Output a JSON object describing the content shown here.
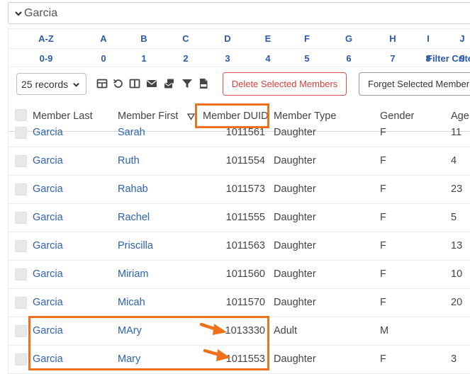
{
  "search": {
    "value": "Garcia"
  },
  "letters_row1": [
    "A-Z",
    "A",
    "B",
    "C",
    "D",
    "E",
    "F",
    "G",
    "H",
    "I",
    "J"
  ],
  "letters_row2": [
    "0-9",
    "0",
    "1",
    "2",
    "3",
    "4",
    "5",
    "6",
    "7",
    "8",
    "9"
  ],
  "filter_link": "Filter Criter",
  "toolbar": {
    "records_select": "25 records",
    "delete_label": "Delete Selected Members",
    "forget_label": "Forget Selected Member",
    "icons": [
      "table-icon",
      "undo-icon",
      "columns-icon",
      "envelope-icon",
      "mail-merge-icon",
      "filter-icon",
      "csv-icon"
    ]
  },
  "table": {
    "headers": [
      "Member Last",
      "Member First",
      "Member DUID",
      "Member Type",
      "Gender",
      "Age"
    ],
    "rows": [
      {
        "last": "Garcia",
        "first": "Sarah",
        "duid": "1011561",
        "type": "Daughter",
        "gender": "F",
        "age": "11"
      },
      {
        "last": "Garcia",
        "first": "Ruth",
        "duid": "1011554",
        "type": "Daughter",
        "gender": "F",
        "age": "4"
      },
      {
        "last": "Garcia",
        "first": "Rahab",
        "duid": "1011573",
        "type": "Daughter",
        "gender": "F",
        "age": "23"
      },
      {
        "last": "Garcia",
        "first": "Rachel",
        "duid": "1011555",
        "type": "Daughter",
        "gender": "F",
        "age": "5"
      },
      {
        "last": "Garcia",
        "first": "Priscilla",
        "duid": "1011563",
        "type": "Daughter",
        "gender": "F",
        "age": "13"
      },
      {
        "last": "Garcia",
        "first": "Miriam",
        "duid": "1011560",
        "type": "Daughter",
        "gender": "F",
        "age": "10"
      },
      {
        "last": "Garcia",
        "first": "Micah",
        "duid": "1011570",
        "type": "Daughter",
        "gender": "F",
        "age": "20"
      },
      {
        "last": "Garcia",
        "first": "MAry",
        "duid": "1013330",
        "type": "Adult",
        "gender": "M",
        "age": ""
      },
      {
        "last": "Garcia",
        "first": "Mary",
        "duid": "1011553",
        "type": "Daughter",
        "gender": "F",
        "age": "3"
      }
    ]
  },
  "colors": {
    "link": "#2a63b7",
    "highlight": "#f26f1c",
    "danger": "#d43f3a"
  }
}
